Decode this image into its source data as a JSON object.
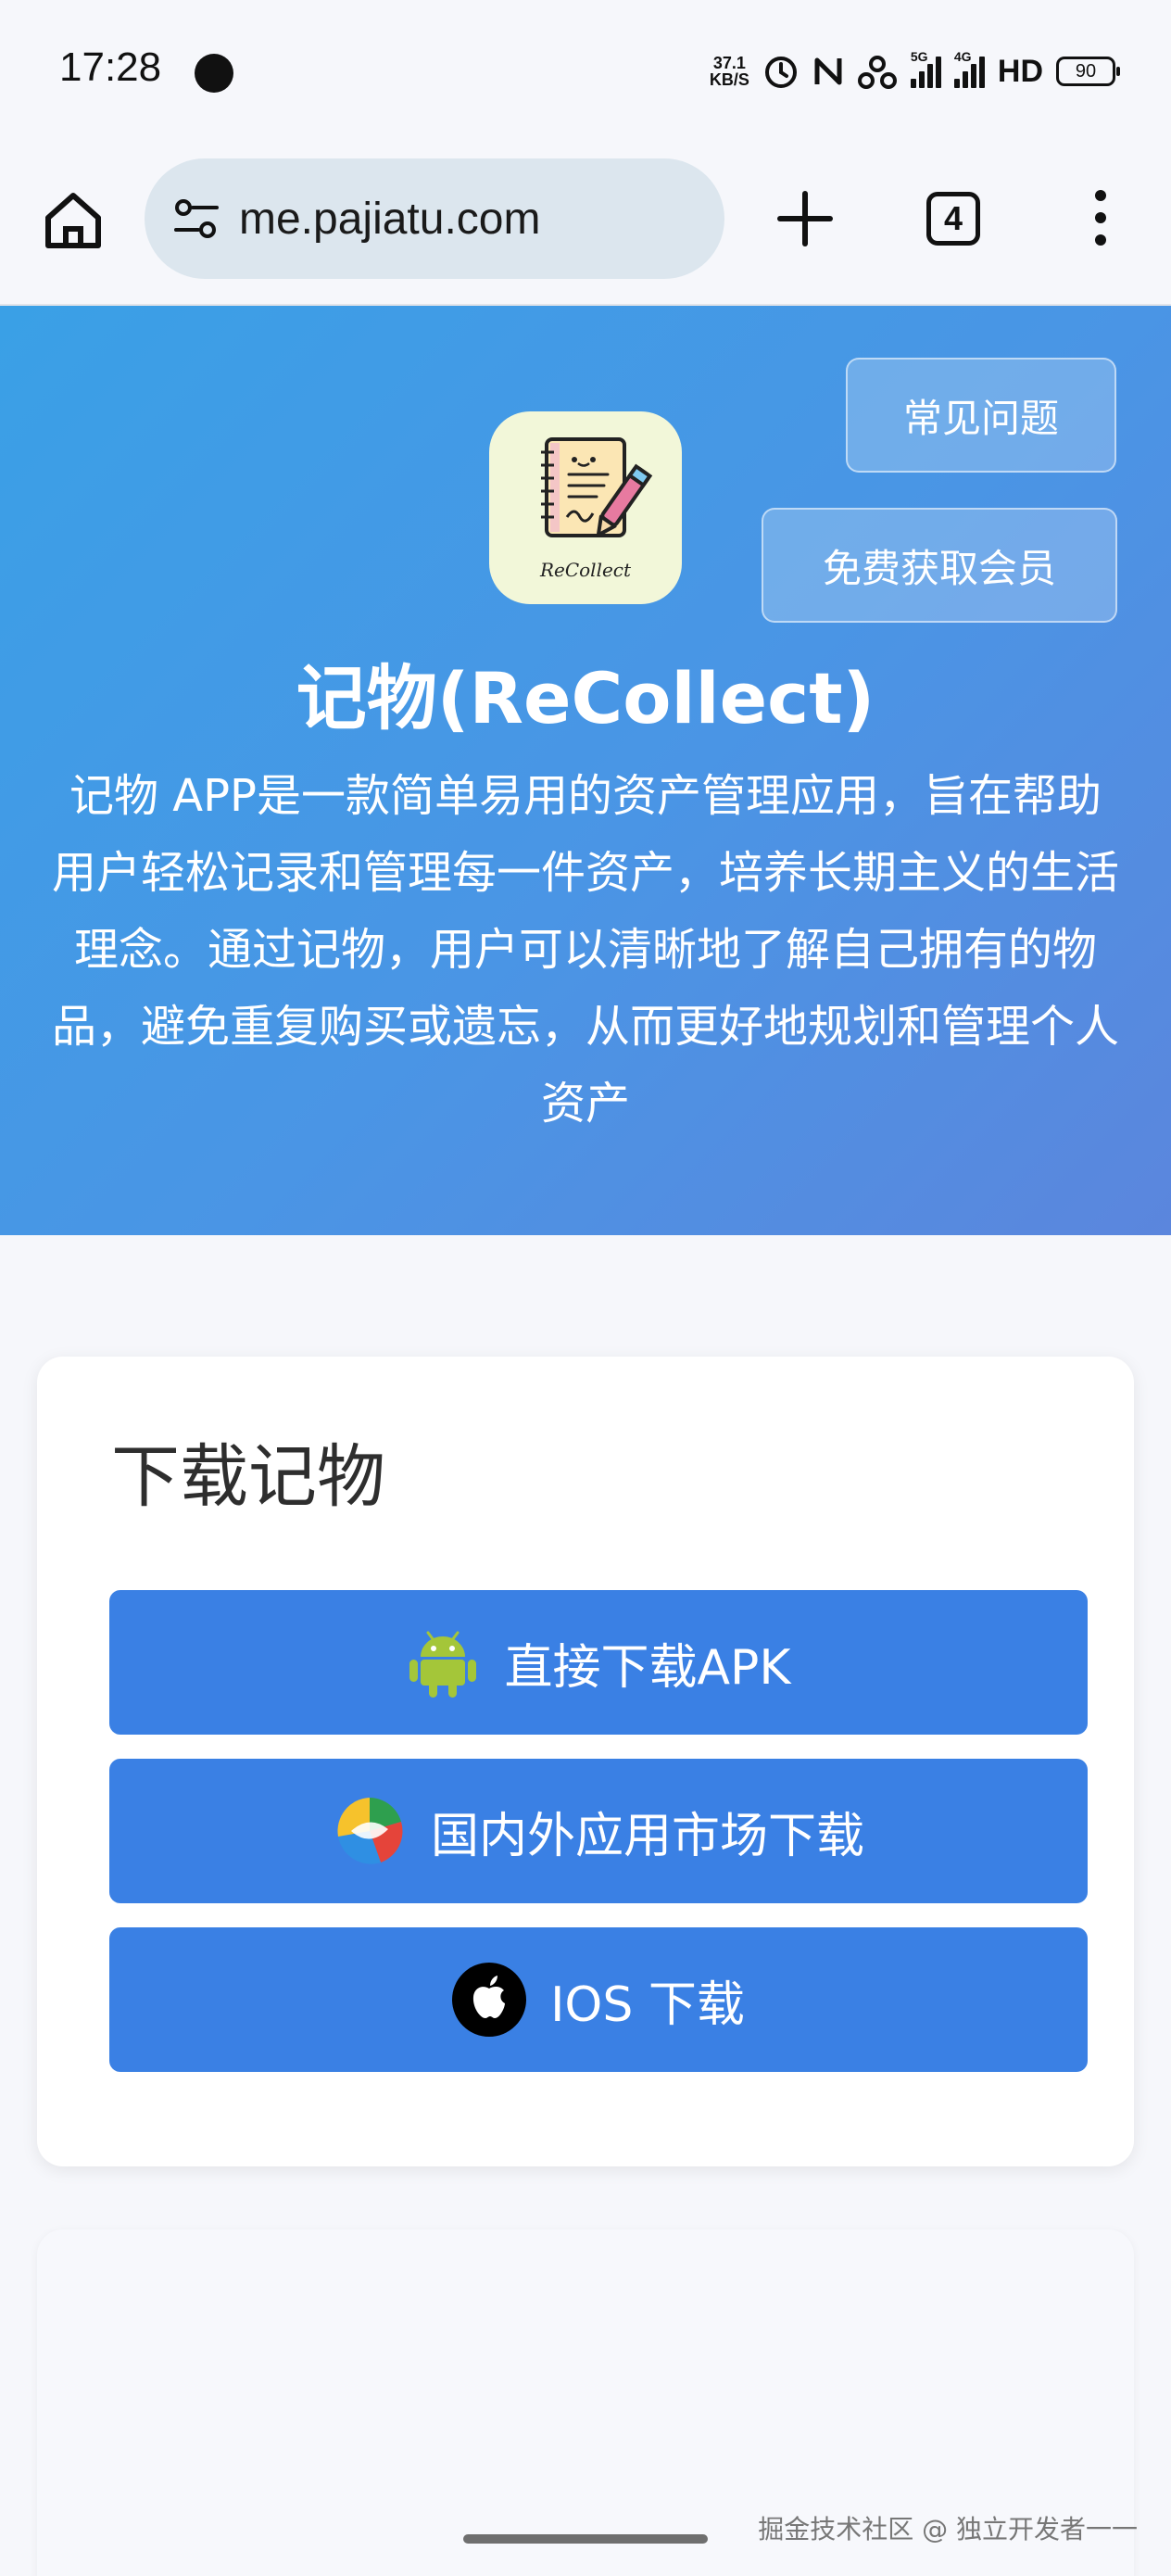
{
  "status_bar": {
    "time": "17:28",
    "net_speed_value": "37.1",
    "net_speed_unit": "KB/S",
    "signal1_tag": "5G",
    "signal2_tag": "4G",
    "hd_label": "HD",
    "battery": "90"
  },
  "browser": {
    "url": "me.pajiatu.com",
    "tab_count": "4"
  },
  "hero": {
    "faq_label": "常见问题",
    "vip_label": "免费获取会员",
    "icon_caption": "ReCollect",
    "title": "记物(ReCollect)",
    "description": "记物 APP是一款简单易用的资产管理应用，旨在帮助用户轻松记录和管理每一件资产，培养长期主义的生活理念。通过记物，用户可以清晰地了解自己拥有的物品，避免重复购买或遗忘，从而更好地规划和管理个人资产"
  },
  "download": {
    "title": "下载记物",
    "apk_label": "直接下载APK",
    "store_label": "国内外应用市场下载",
    "ios_label": "IOS 下载"
  },
  "footer": {
    "watermark": "掘金技术社区 @ 独立开发者一一"
  },
  "colors": {
    "hero_start": "#3aa0e6",
    "hero_end": "#5b86dd",
    "button_blue": "#3a80e4",
    "android_green": "#a4c639"
  }
}
